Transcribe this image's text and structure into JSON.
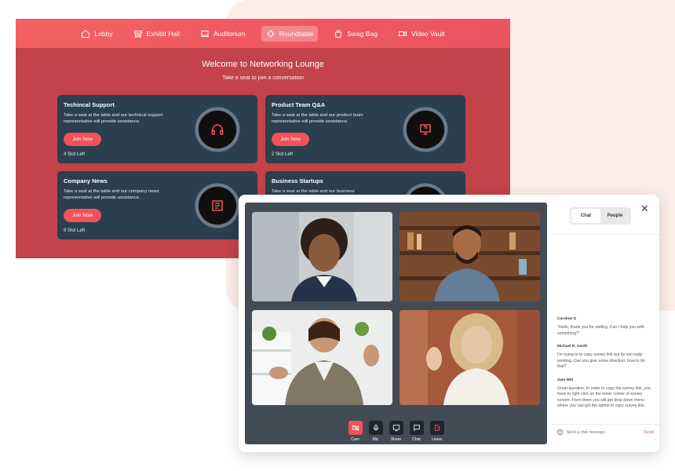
{
  "nav": [
    {
      "label": "Lobby",
      "icon": "home-icon",
      "active": false
    },
    {
      "label": "Exhibit Hall",
      "icon": "booth-icon",
      "active": false
    },
    {
      "label": "Auditorium",
      "icon": "monitor-icon",
      "active": false
    },
    {
      "label": "Roundtable",
      "icon": "roundtable-icon",
      "active": true
    },
    {
      "label": "Swag Bag",
      "icon": "bag-icon",
      "active": false
    },
    {
      "label": "Video Vault",
      "icon": "video-icon",
      "active": false
    }
  ],
  "lounge": {
    "title": "Welcome to Networking Lounge",
    "subtitle": "Take a seat to join a conversation"
  },
  "cards": [
    {
      "title": "Techincal Support",
      "desc": "Take a seat at the table and our technical support representative will provide assistance.",
      "button": "Join Now",
      "slots": "4 Slot Left",
      "icon": "headphones-icon"
    },
    {
      "title": "Product Team Q&A",
      "desc": "Take a seat at the table and our product team representative will provide assistance.",
      "button": "Join Now",
      "slots": "2 Slot Left",
      "icon": "question-monitor-icon"
    },
    {
      "title": "Company News",
      "desc": "Take a seat at the table and our company news representative will provide assistance.",
      "button": "Join Now",
      "slots": "9 Slot Left",
      "icon": "newspaper-icon"
    },
    {
      "title": "Business Startups",
      "desc": "Take a seat at the table and our business",
      "button": "",
      "slots": "",
      "icon": "briefcase-icon"
    }
  ],
  "call": {
    "controls": [
      {
        "label": "Cam",
        "icon": "camera-off-icon",
        "active": true
      },
      {
        "label": "Mic",
        "icon": "mic-icon",
        "active": false
      },
      {
        "label": "Share",
        "icon": "share-screen-icon",
        "active": false
      },
      {
        "label": "Chat",
        "icon": "chat-icon",
        "active": false
      },
      {
        "label": "Leave",
        "icon": "leave-icon",
        "active": false
      }
    ],
    "tabs": [
      "Chat",
      "People"
    ],
    "active_tab": "Chat",
    "messages": [
      {
        "name": "Caroline D",
        "text": "\"Hello, thank you for visiting. Can I help you with something?\""
      },
      {
        "name": "Michael R. Smith",
        "text": "I'm trying to to copy survey link but its not really working. Can you give some direction, how to do that?"
      },
      {
        "name": "Sam Will",
        "text": "Great question. In order to copy the survey link, you have to right click on the lower corner of survey screen. From there you will get drop down menu where you can get the option to copy survey link."
      }
    ],
    "composer_placeholder": "Send a chat message",
    "send_label": "Send"
  }
}
